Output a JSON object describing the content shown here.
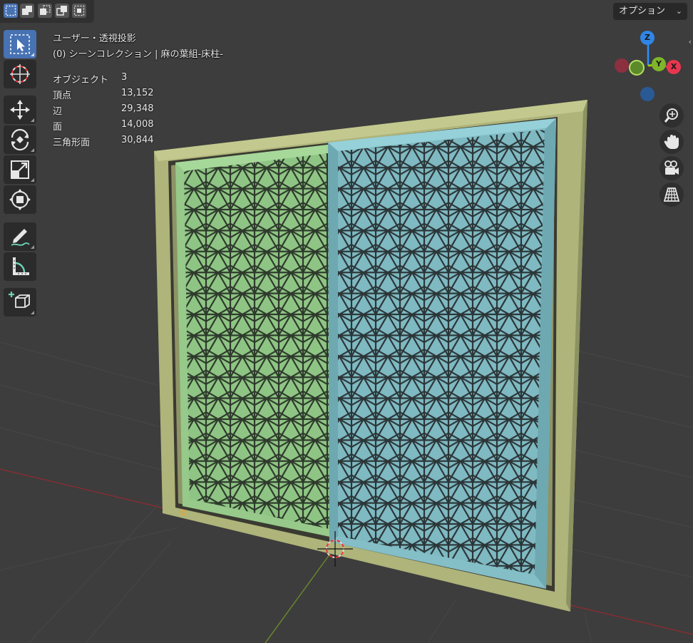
{
  "header": {
    "selection_modes": [
      "select-box-new-icon",
      "select-box-extend-icon",
      "select-box-subtract-icon",
      "select-box-invert-icon",
      "select-box-intersect-icon"
    ],
    "options_label": "オプション"
  },
  "viewport": {
    "view_name": "ユーザー・透視投影",
    "collection_line": "(0) シーンコレクション | 麻の葉組-床柱-",
    "stats": [
      {
        "label": "オブジェクト",
        "value": "3"
      },
      {
        "label": "頂点",
        "value": "13,152"
      },
      {
        "label": "辺",
        "value": "29,348"
      },
      {
        "label": "面",
        "value": "14,008"
      },
      {
        "label": "三角形面",
        "value": "30,844"
      }
    ]
  },
  "toolbar": {
    "tools": [
      "select-box-icon",
      "cursor-icon",
      "move-icon",
      "rotate-icon",
      "scale-icon",
      "transform-icon",
      "annotate-icon",
      "measure-icon",
      "add-cube-icon"
    ],
    "active_tool": "select-box-icon"
  },
  "gizmo": {
    "axes": [
      "Z",
      "Y",
      "X"
    ],
    "colors": {
      "x": "#ff3352",
      "y": "#8bdc00",
      "z": "#2890ff"
    }
  },
  "nav_buttons": [
    "zoom-icon",
    "hand-pan-icon",
    "camera-icon",
    "perspective-grid-icon"
  ],
  "colors": {
    "background": "#3d3d3d",
    "frame": "#aeb47a",
    "left_panel": "#8fc584",
    "right_panel": "#7fb9c2",
    "accent": "#4772b3"
  }
}
